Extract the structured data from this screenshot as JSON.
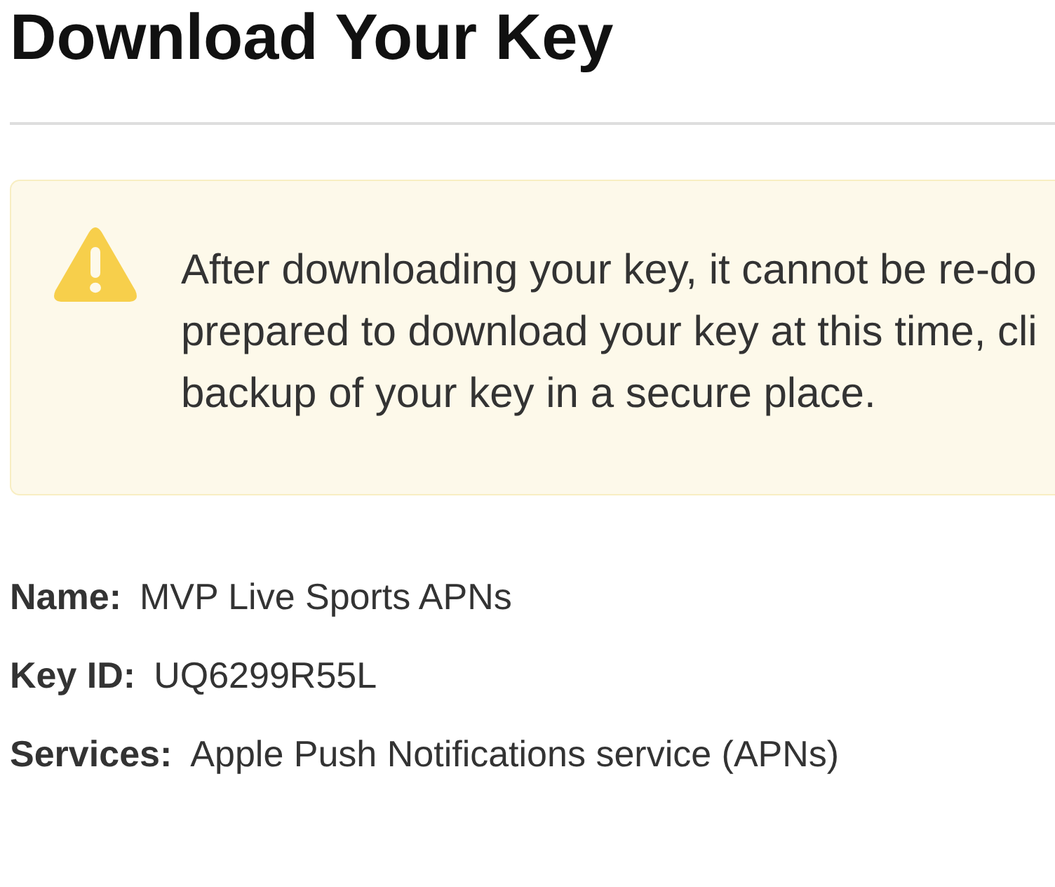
{
  "page": {
    "title": "Download Your Key"
  },
  "warning": {
    "message_lines": [
      "After downloading your key, it cannot be re-do",
      "prepared to download your key at this time, cli",
      "backup of your key in a secure place."
    ]
  },
  "details": [
    {
      "label": "Name:",
      "value": "MVP Live Sports APNs"
    },
    {
      "label": "Key ID:",
      "value": "UQ6299R55L"
    },
    {
      "label": "Services:",
      "value": "Apple Push Notifications service (APNs)"
    }
  ]
}
